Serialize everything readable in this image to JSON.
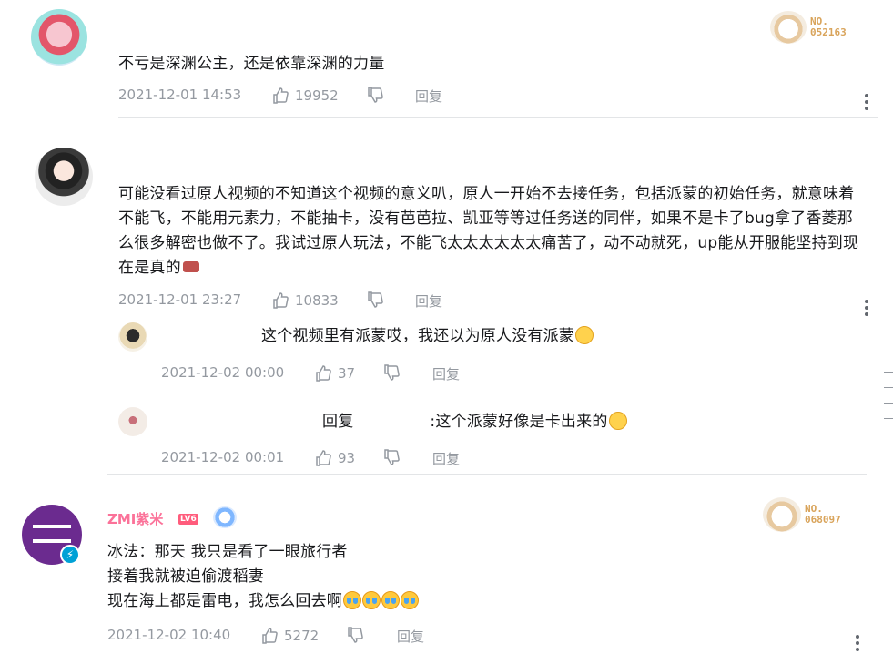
{
  "comments": [
    {
      "text": "不亏是深渊公主，还是依靠深渊的力量",
      "time": "2021-12-01 14:53",
      "likes": "19952",
      "reply_label": "回复",
      "fan_badge": "NO.\n052163"
    },
    {
      "text": "可能没看过原人视频的不知道这个视频的意义叭，原人一开始不去接任务，包括派蒙的初始任务，就意味着不能飞，不能用元素力，不能抽卡，没有芭芭拉、凯亚等等过任务送的同伴，如果不是卡了bug拿了香菱那么很多解密也做不了。我试过原人玩法，不能飞太太太太太太痛苦了，动不动就死，up能从开服能坚持到现在是真的",
      "time": "2021-12-01 23:27",
      "likes": "10833",
      "reply_label": "回复",
      "sub_replies": [
        {
          "text": "这个视频里有派蒙哎，我还以为原人没有派蒙",
          "time": "2021-12-02 00:00",
          "likes": "37",
          "reply_label": "回复"
        },
        {
          "prefix": "回复",
          "text": ":这个派蒙好像是卡出来的",
          "time": "2021-12-02 00:01",
          "likes": "93",
          "reply_label": "回复"
        }
      ]
    },
    {
      "username": "ZMI紫米",
      "level": "LV6",
      "text_lines": [
        "冰法：那天 我只是看了一眼旅行者",
        "接着我就被迫偷渡稻妻",
        "现在海上都是雷电，我怎么回去啊"
      ],
      "time": "2021-12-02 10:40",
      "likes": "5272",
      "reply_label": "回复",
      "fan_badge": "NO.\n068097"
    }
  ],
  "colors": {
    "meta": "#9499a0",
    "username": "#fb7299",
    "badge": "#d9a45b"
  }
}
